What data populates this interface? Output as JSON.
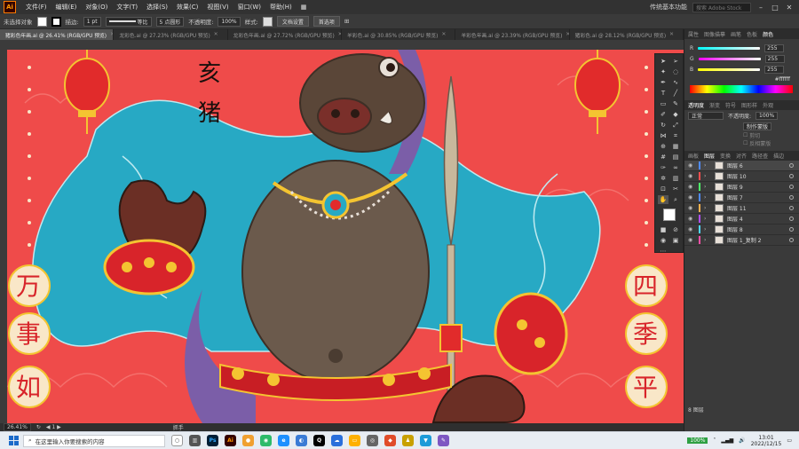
{
  "menubar": {
    "logo": "Ai",
    "items": [
      "文件(F)",
      "编辑(E)",
      "对象(O)",
      "文字(T)",
      "选择(S)",
      "效果(C)",
      "视图(V)",
      "窗口(W)",
      "帮助(H)"
    ],
    "workspace": "传统基本功能",
    "search_placeholder": "搜索 Adobe Stock"
  },
  "controlbar": {
    "selection": "未选择对象",
    "stroke_label": "描边:",
    "stroke_value": "1 pt",
    "stroke_style": "等比",
    "brush": "5 点圆形",
    "opacity_label": "不透明度:",
    "opacity_value": "100%",
    "style_label": "样式:",
    "doc_settings": "文档设置",
    "preferences": "首选项"
  },
  "tabs": [
    {
      "label": "猪彩色年画.ai @ 26.41% (RGB/GPU 预览)",
      "active": true
    },
    {
      "label": "龙彩色.ai @ 27.23% (RGB/GPU 预览)",
      "active": false
    },
    {
      "label": "龙彩色年画.ai @ 27.72% (RGB/GPU 预览)",
      "active": false
    },
    {
      "label": "羊彩色.ai @ 30.85% (RGB/GPU 预览)",
      "active": false
    },
    {
      "label": "羊彩色年画.ai @ 23.39% (RGB/GPU 预览)",
      "active": false
    },
    {
      "label": "猪彩色.ai @ 28.12% (RGB/GPU 预览)",
      "active": false
    }
  ],
  "artwork": {
    "title_chars": [
      "亥",
      "猪"
    ],
    "left_chars": [
      "万",
      "事",
      "如"
    ],
    "right_chars": [
      "四",
      "季",
      "平"
    ],
    "colors": {
      "background": "#ef4b4a",
      "cloth": "#27a9c4",
      "boar": "#6b5a4c",
      "gold": "#f4c431",
      "purple": "#7b5ea8"
    }
  },
  "statusbar": {
    "zoom": "26.41%",
    "tool": "抓手"
  },
  "color_panel": {
    "tabs": [
      "属性",
      "图像描摹",
      "画笔",
      "色板",
      "颜色"
    ],
    "channels": [
      {
        "name": "R",
        "value": "255"
      },
      {
        "name": "G",
        "value": "255"
      },
      {
        "name": "B",
        "value": "255"
      }
    ],
    "hex": "ffffff"
  },
  "transparency_panel": {
    "tabs": [
      "透明度",
      "渐变",
      "符号",
      "图形样",
      "外观"
    ],
    "mode": "正常",
    "opacity_label": "不透明度:",
    "opacity_value": "100%",
    "mask_button": "制作蒙版",
    "clip": "剪切",
    "invert": "反相蒙版"
  },
  "layers_panel": {
    "tabs": [
      "画板",
      "图层",
      "变换",
      "对齐",
      "路径查",
      "描边"
    ],
    "layers": [
      {
        "name": "图层 6",
        "color": "#4f8bff"
      },
      {
        "name": "图层 10",
        "color": "#ff4f4f"
      },
      {
        "name": "图层 9",
        "color": "#4fff6a"
      },
      {
        "name": "图层 7",
        "color": "#4f8bff"
      },
      {
        "name": "图层 11",
        "color": "#ffb34f"
      },
      {
        "name": "图层 4",
        "color": "#b04fff"
      },
      {
        "name": "图层 8",
        "color": "#4fd7ff"
      },
      {
        "name": "图层 1_复制 2",
        "color": "#ff4fa8"
      }
    ],
    "footer": "8 图层"
  },
  "taskbar": {
    "search_placeholder": "在这里输入你要搜索的内容",
    "battery": "100%",
    "time": "13:01",
    "date": "2022/12/15"
  }
}
